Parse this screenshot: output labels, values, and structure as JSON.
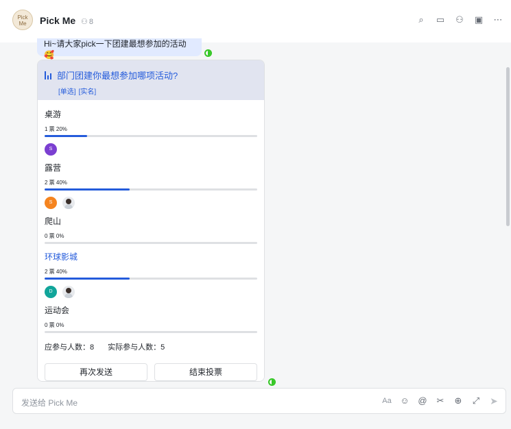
{
  "header": {
    "avatar_text": "Pick Me",
    "title": "Pick Me",
    "member_count": "8",
    "icons": [
      "search-icon",
      "video-icon",
      "add-member-icon",
      "calendar-icon",
      "more-icon"
    ]
  },
  "messages": {
    "intro": "Hi~请大家pick一下团建最想参加的活动🥰"
  },
  "poll": {
    "title": "部门团建你最想参加哪项活动?",
    "tags": [
      "[单选]",
      "[实名]"
    ],
    "options": [
      {
        "label": "桌游",
        "votes": "1 票 20%",
        "percent": 20,
        "voters": [
          {
            "initial": "S",
            "color": "#7b3fd1"
          }
        ]
      },
      {
        "label": "露营",
        "votes": "2 票 40%",
        "percent": 40,
        "voters": [
          {
            "initial": "S",
            "color": "#f5841f"
          },
          {
            "initial": "",
            "color": "photo"
          }
        ]
      },
      {
        "label": "爬山",
        "votes": "0 票 0%",
        "percent": 0,
        "voters": []
      },
      {
        "label": "环球影城",
        "votes": "2 票 40%",
        "percent": 40,
        "voters": [
          {
            "initial": "D",
            "color": "#11a59a"
          },
          {
            "initial": "",
            "color": "photo"
          }
        ],
        "highlighted": true
      },
      {
        "label": "运动会",
        "votes": "0 票 0%",
        "percent": 0,
        "voters": []
      }
    ],
    "expected": "应参与人数：8",
    "actual": "实际参与人数：5",
    "resend_label": "再次发送",
    "end_label": "结束投票"
  },
  "composer": {
    "placeholder": "发送给 Pick Me",
    "tools": [
      "Aa",
      "☺",
      "@",
      "✂",
      "⊕",
      "⤢",
      "➤"
    ]
  }
}
